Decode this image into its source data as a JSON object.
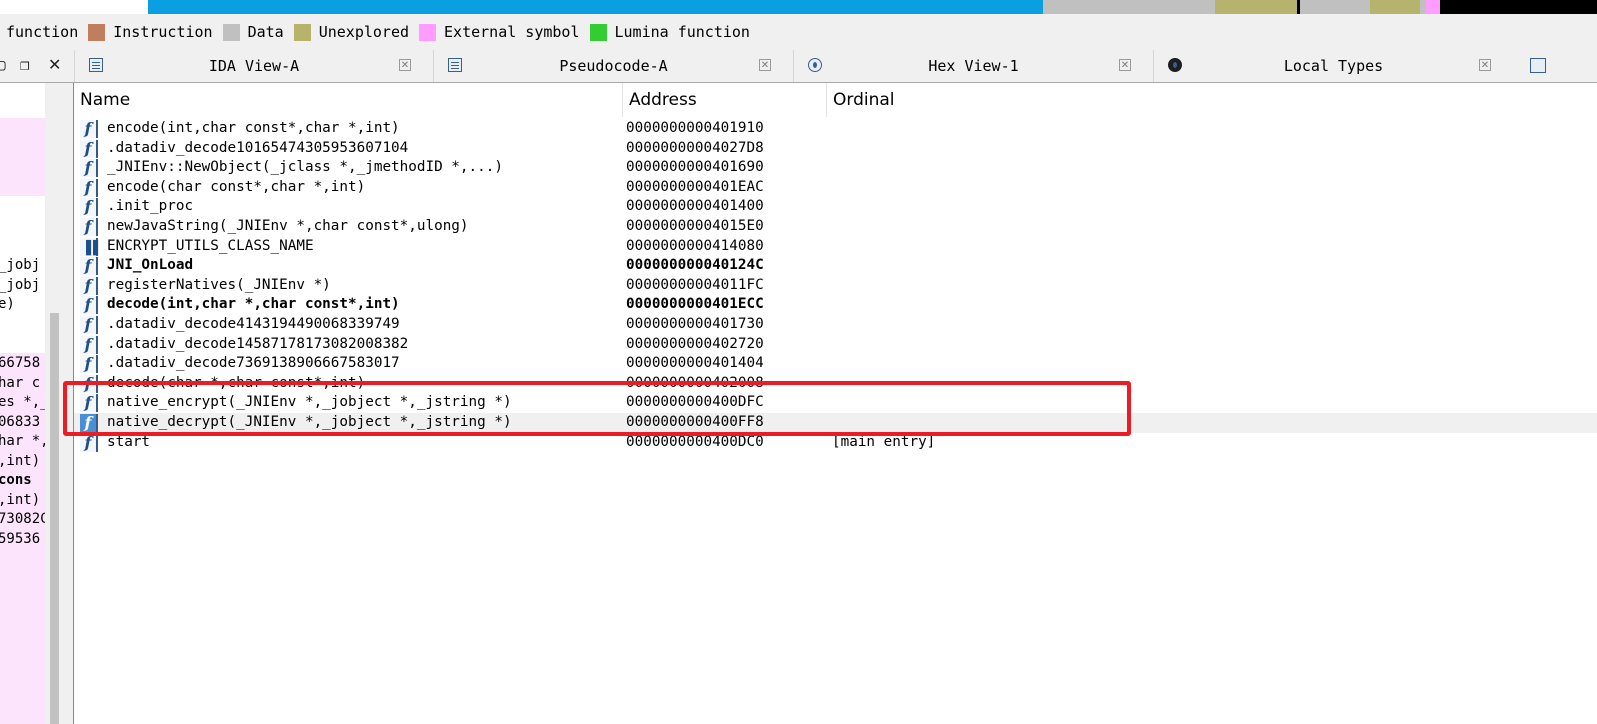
{
  "navband": {
    "colors": {
      "white": "#ffffff",
      "blue": "#0a9fe0",
      "gray": "#c0c0c0",
      "olive": "#b6b46c",
      "black": "#000000",
      "pink": "#ff9cff"
    }
  },
  "legend": {
    "items": [
      {
        "label": "function",
        "color": ""
      },
      {
        "label": "Instruction",
        "color": "#bf7f5f"
      },
      {
        "label": "Data",
        "color": "#c0c0c0"
      },
      {
        "label": "Unexplored",
        "color": "#b6b46c"
      },
      {
        "label": "External symbol",
        "color": "#ff9cff"
      },
      {
        "label": "Lumina function",
        "color": "#33cc33"
      }
    ]
  },
  "left_controls": {
    "restore_icon": "▢",
    "float_icon": "❐",
    "close_icon": "✕"
  },
  "tabs": [
    {
      "label": "IDA View-A",
      "icon": "list-icon",
      "close": "✕"
    },
    {
      "label": "Pseudocode-A",
      "icon": "list-icon",
      "close": "✕"
    },
    {
      "label": "Hex View-1",
      "icon": "hex-icon",
      "close": "✕"
    },
    {
      "label": "Local Types",
      "icon": "info-icon",
      "close": "✕"
    }
  ],
  "left_panel": {
    "fragments": [
      "_jobj",
      "_jobj",
      "e)",
      "66758",
      "har c",
      "es *,_",
      "06833",
      "har *,",
      ",int)",
      " cons",
      ",int)",
      "73082C",
      "59536"
    ]
  },
  "table": {
    "headers": {
      "name": "Name",
      "address": "Address",
      "ordinal": "Ordinal"
    },
    "rows": [
      {
        "icon": "function-icon",
        "name": "encode(int,char const*,char *,int)",
        "address": "0000000000401910",
        "ordinal": ""
      },
      {
        "icon": "function-icon",
        "name": ".datadiv_decode10165474305953607104",
        "address": "00000000004027D8",
        "ordinal": ""
      },
      {
        "icon": "function-icon",
        "name": "_JNIEnv::NewObject(_jclass *,_jmethodID *,...)",
        "address": "0000000000401690",
        "ordinal": ""
      },
      {
        "icon": "function-icon",
        "name": "encode(char const*,char *,int)",
        "address": "0000000000401EAC",
        "ordinal": ""
      },
      {
        "icon": "function-icon",
        "name": ".init_proc",
        "address": "0000000000401400",
        "ordinal": ""
      },
      {
        "icon": "function-icon",
        "name": "newJavaString(_JNIEnv *,char const*,ulong)",
        "address": "00000000004015E0",
        "ordinal": ""
      },
      {
        "icon": "data-icon",
        "name": "ENCRYPT_UTILS_CLASS_NAME",
        "address": "0000000000414080",
        "ordinal": ""
      },
      {
        "icon": "function-icon",
        "name": "JNI_OnLoad",
        "address": "000000000040124C",
        "ordinal": "",
        "bold": true
      },
      {
        "icon": "function-icon",
        "name": "registerNatives(_JNIEnv *)",
        "address": "00000000004011FC",
        "ordinal": ""
      },
      {
        "icon": "function-icon",
        "name": "decode(int,char *,char const*,int)",
        "address": "0000000000401ECC",
        "ordinal": "",
        "bold": true
      },
      {
        "icon": "function-icon",
        "name": ".datadiv_decode4143194490068339749",
        "address": "0000000000401730",
        "ordinal": ""
      },
      {
        "icon": "function-icon",
        "name": ".datadiv_decode14587178173082008382",
        "address": "0000000000402720",
        "ordinal": ""
      },
      {
        "icon": "function-icon",
        "name": ".datadiv_decode7369138906667583017",
        "address": "0000000000401404",
        "ordinal": ""
      },
      {
        "icon": "function-icon",
        "name": "decode(char *,char const*,int)",
        "address": "0000000000402008",
        "ordinal": ""
      },
      {
        "icon": "function-icon",
        "name": "native_encrypt(_JNIEnv *,_jobject *,_jstring *)",
        "address": "0000000000400DFC",
        "ordinal": ""
      },
      {
        "icon": "function-icon",
        "name": "native_decrypt(_JNIEnv *,_jobject *,_jstring *)",
        "address": "0000000000400FF8",
        "ordinal": "",
        "selected": true
      },
      {
        "icon": "function-icon",
        "name": "start",
        "address": "0000000000400DC0",
        "ordinal": "[main entry]"
      }
    ]
  },
  "annotation": {
    "color": "#ec1c24"
  }
}
